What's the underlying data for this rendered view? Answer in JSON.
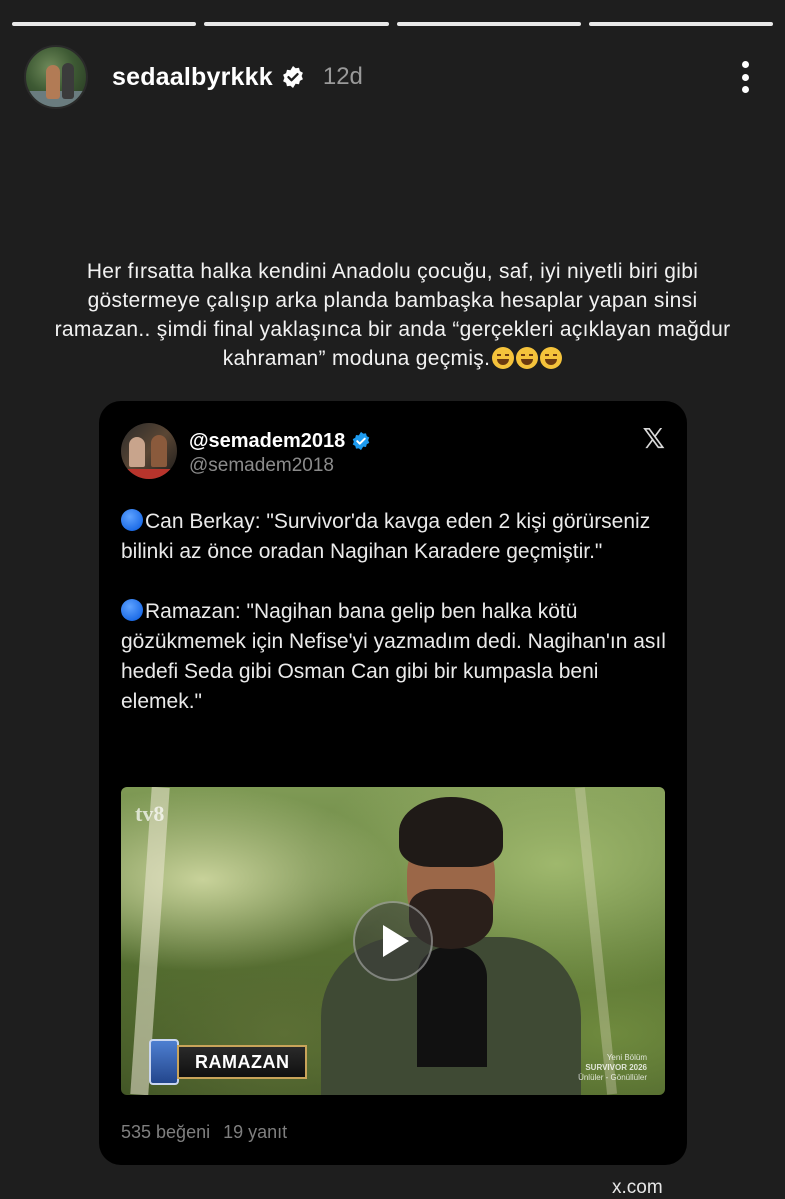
{
  "story": {
    "progress_segments": 4,
    "current_segment": 4
  },
  "header": {
    "username": "sedaalbyrkkk",
    "time": "12d",
    "verified": true,
    "more_icon": "more-vertical-icon"
  },
  "caption": {
    "text": "Her fırsatta halka kendini Anadolu çocuğu, saf, iyi niyetli biri gibi göstermeye çalışıp arka planda bambaşka hesaplar yapan sinsi ramazan.. şimdi final yaklaşınca bir anda “gerçekleri açıklayan mağdur kahraman” moduna geçmiş.",
    "emoji_count": 3,
    "emoji": "laughing-tears-emoji"
  },
  "tweet": {
    "display_name": "@semadem2018",
    "handle": "@semadem2018",
    "platform_icon": "x-logo-icon",
    "paragraphs": [
      "Can Berkay: \"Survivor'da kavga eden 2 kişi görürseniz bilinki az önce oradan Nagihan Karadere geçmiştir.\"",
      "Ramazan: \"Nagihan bana gelip ben halka kötü gözükmemek için Nefise'yi yazmadım dedi. Nagihan'ın asıl hedefi Seda gibi Osman Can gibi bir kumpasla beni elemek.\""
    ],
    "video": {
      "watermark": "tv8",
      "name_tag": "RAMAZAN",
      "corner_text": [
        "Yeni Bölüm",
        "SURVIVOR 2026",
        "Ünlüler - Gönüllüler"
      ]
    },
    "likes": "535 beğeni",
    "replies": "19 yanıt"
  },
  "footer": {
    "source": "x.com"
  }
}
